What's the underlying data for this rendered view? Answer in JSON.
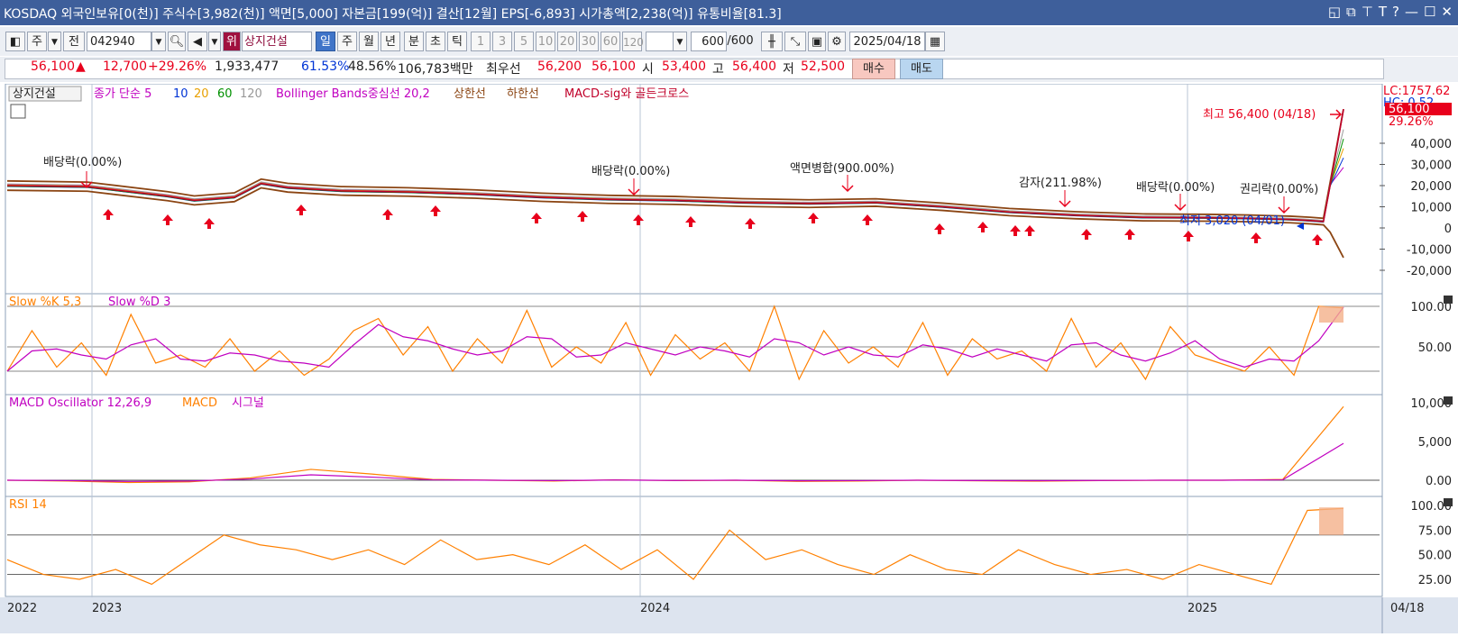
{
  "window": {
    "title": "KOSDAQ 외국인보유[0(천)] 주식수[3,982(천)] 액면[5,000] 자본금[199(억)] 결산[12월] EPS[-6,893] 시가총액[2,238(억)] 유통비율[81.3]"
  },
  "toolbar": {
    "btn_ju": "주",
    "btn_jeon": "전",
    "code": "042940",
    "rank": "위",
    "stock_name": "상지건설",
    "periods": [
      "일",
      "주",
      "월",
      "년",
      "분",
      "초",
      "틱"
    ],
    "intervals": [
      "1",
      "3",
      "5",
      "10",
      "20",
      "30",
      "60",
      "120"
    ],
    "count": "600",
    "count_total": "/600",
    "date": "2025/04/18"
  },
  "quote": {
    "price": "56,100",
    "arrow": "▲",
    "change": "12,700",
    "rate": "+29.26%",
    "volume": "1,933,477",
    "vol_ratio": "61.53%",
    "turnover": "48.56%",
    "amount": "106,783백만",
    "ask_label": "최우선",
    "ask": "56,200",
    "bid": "56,100",
    "open_label": "시",
    "open": "53,400",
    "high_label": "고",
    "high": "56,400",
    "low_label": "저",
    "low": "52,500",
    "buy": "매수",
    "sell": "매도"
  },
  "price_pane": {
    "legend": {
      "stock": "상지건설",
      "ma_label": "종가 단순 5",
      "ma_periods": [
        "10",
        "20",
        "60",
        "120"
      ],
      "bollinger": "Bollinger Bands중심선 20,2",
      "upper": "상한선",
      "lower": "하한선",
      "macd_sig": "MACD-sig와 골든크로스"
    },
    "lc_label": "LC:1757.62",
    "hc_label": "HC: 0.52",
    "price_tag": "56,100",
    "pct_tag": "29.26%",
    "high_note": "최고 56,400 (04/18)",
    "low_note": "최저 3,020 (04/01)",
    "annotations": [
      "배당락(0.00%)",
      "배당락(0.00%)",
      "액면병합(900.00%)",
      "감자(211.98%)",
      "배당락(0.00%)",
      "권리락(0.00%)"
    ]
  },
  "stoch_pane": {
    "legend_k": "Slow %K 5,3",
    "legend_d": "Slow %D 3"
  },
  "macd_pane": {
    "legend_osc": "MACD Oscillator 12,26,9",
    "legend_macd": "MACD",
    "legend_sig": "시그널"
  },
  "rsi_pane": {
    "legend": "RSI 14"
  },
  "x_axis": {
    "labels": [
      "2022",
      "2023",
      "2024",
      "2025"
    ],
    "right_label": "04/18"
  },
  "chart_data": [
    {
      "type": "line",
      "name": "price",
      "y_ticks": [
        "40,000",
        "30,000",
        "20,000",
        "10,000",
        "0",
        "-10,000",
        "-20,000"
      ],
      "x": [
        0,
        0.06,
        0.12,
        0.14,
        0.17,
        0.19,
        0.21,
        0.25,
        0.3,
        0.35,
        0.4,
        0.45,
        0.5,
        0.55,
        0.6,
        0.65,
        0.7,
        0.75,
        0.8,
        0.85,
        0.9,
        0.93,
        0.96,
        0.975,
        0.985,
        0.99,
        1.0
      ],
      "values": [
        20000,
        19500,
        15000,
        13000,
        14500,
        21000,
        19000,
        17500,
        17000,
        16000,
        14500,
        13500,
        13000,
        12000,
        11500,
        12000,
        10000,
        7500,
        6000,
        5000,
        4800,
        4500,
        4000,
        3500,
        3020,
        20000,
        56100
      ]
    },
    {
      "type": "line",
      "name": "Slow %K 5,3",
      "y_ticks": [
        "100.00",
        "50.00"
      ],
      "values": [
        20,
        70,
        25,
        55,
        15,
        90,
        30,
        40,
        25,
        60,
        20,
        45,
        15,
        35,
        70,
        85,
        40,
        75,
        20,
        60,
        30,
        95,
        25,
        50,
        30,
        80,
        15,
        65,
        35,
        55,
        20,
        100,
        10,
        70,
        30,
        50,
        25,
        80,
        15,
        60,
        35,
        45,
        20,
        85,
        25,
        55,
        10,
        75,
        40,
        30,
        20,
        50,
        15,
        100,
        98
      ]
    },
    {
      "type": "line",
      "name": "MACD Oscillator 12,26,9",
      "y_ticks": [
        "10,000",
        "5,000",
        "0.00"
      ],
      "values": [
        0,
        -100,
        -300,
        -200,
        300,
        1400,
        800,
        100,
        0,
        -100,
        50,
        -50,
        0,
        -150,
        -100,
        0,
        -80,
        -120,
        -50,
        0,
        0,
        100,
        9500
      ]
    },
    {
      "type": "line",
      "name": "RSI 14",
      "y_ticks": [
        "100.00",
        "75.00",
        "50.00",
        "25.00"
      ],
      "values": [
        45,
        30,
        25,
        35,
        20,
        45,
        70,
        60,
        55,
        45,
        55,
        40,
        65,
        45,
        50,
        40,
        60,
        35,
        55,
        25,
        75,
        45,
        55,
        40,
        30,
        50,
        35,
        30,
        55,
        40,
        30,
        35,
        25,
        40,
        30,
        20,
        95,
        97
      ]
    }
  ],
  "colors": {
    "up": "#e8001c",
    "down": "#0034d5",
    "title_bg": "#3e5f9b",
    "grid": "#b8c4d6"
  }
}
